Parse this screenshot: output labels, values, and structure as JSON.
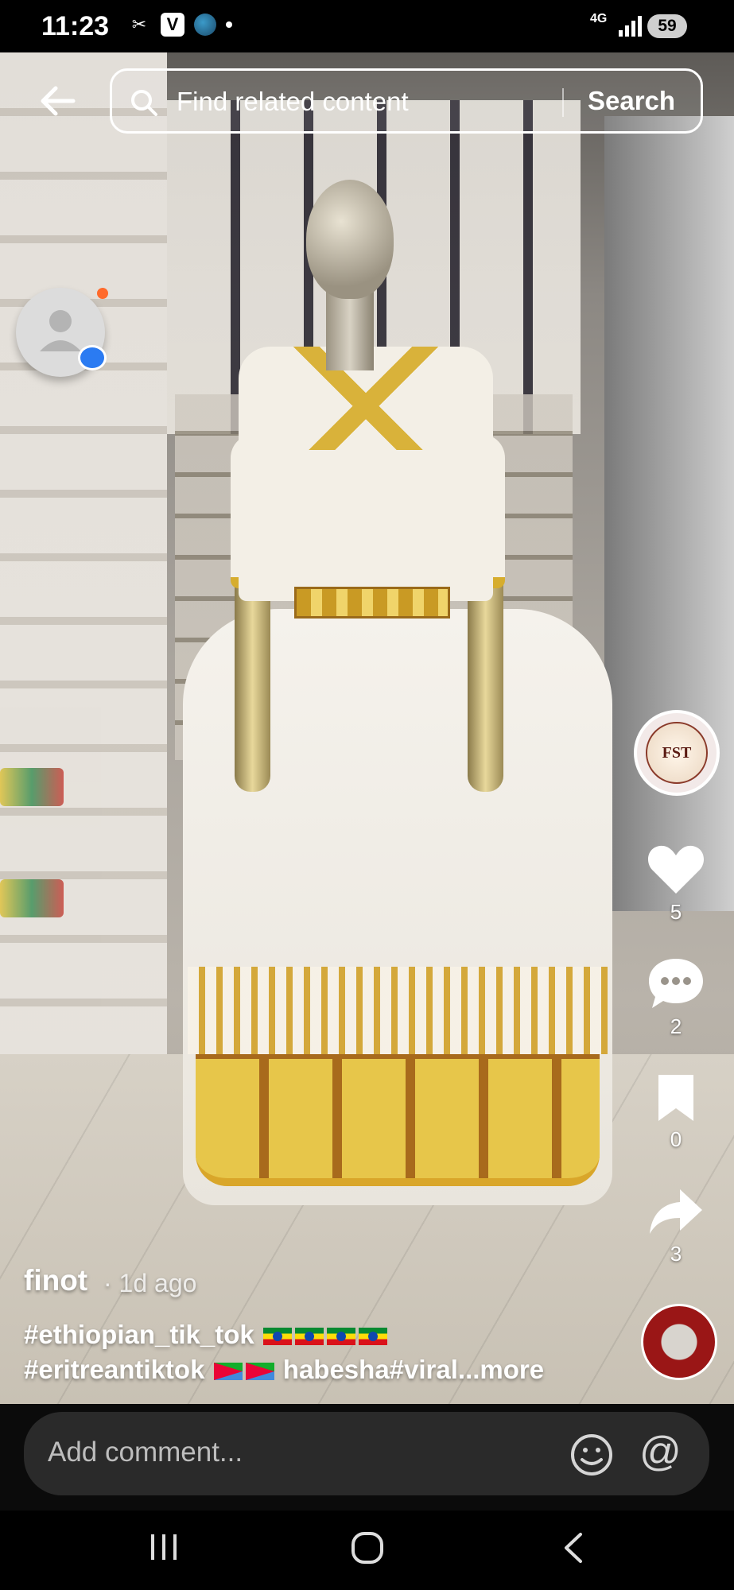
{
  "status_bar": {
    "time": "11:23",
    "icons": [
      "capcut-icon",
      "v-app-icon",
      "globe-icon",
      "notification-dot"
    ],
    "network": "4G",
    "battery": "59"
  },
  "search": {
    "placeholder": "Find related content",
    "button": "Search"
  },
  "post": {
    "author": "finot",
    "time_ago": "· 1d ago",
    "caption_line1": "#ethiopian_tik_tok",
    "caption_line2_a": "#eritreantiktok",
    "caption_line2_b": "habesha#viral",
    "more": "...more"
  },
  "actions": {
    "likes": "5",
    "comments": "2",
    "saves": "0",
    "shares": "3"
  },
  "brand_logo_text": "FST",
  "comment_bar": {
    "placeholder": "Add comment..."
  },
  "colors": {
    "accent_orange": "#ff6a2b",
    "accent_blue": "#2b7bf2"
  }
}
